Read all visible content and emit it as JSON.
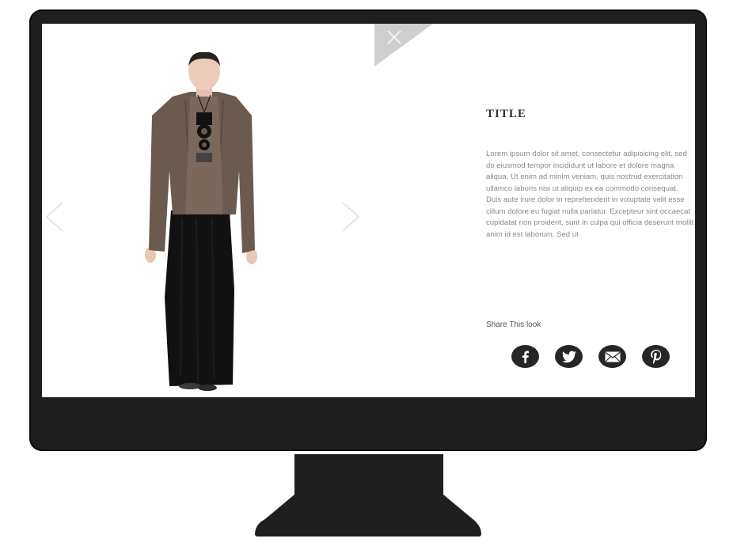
{
  "product": {
    "title": "TITLE",
    "description": "Lorem ipsum dolor sit amet, consectetur adipisicing elit, sed do eiusmod tempor incididunt ut labore et dolore magna aliqua. Ut enim ad minim veniam, quis nostrud exercitation ullamco laboris nisi ut aliquip ex ea commodo consequat. Duis aute irure dolor in reprehenderit in voluptate velit esse cillum dolore eu fugiat nulla pariatur. Excepteur sint occaecat cupidatat non proident, sunt in culpa qui officia deserunt mollit anim id est laborum. Sed ut"
  },
  "share": {
    "label": "Share This look",
    "buttons": [
      {
        "name": "facebook",
        "icon": "facebook-icon"
      },
      {
        "name": "twitter",
        "icon": "twitter-icon"
      },
      {
        "name": "email",
        "icon": "mail-icon"
      },
      {
        "name": "pinterest",
        "icon": "pinterest-icon"
      }
    ]
  },
  "colors": {
    "monitor": "#1f1f1f",
    "close_corner": "#cfcfcf",
    "share_button": "#262626",
    "body_text": "#8a8a8a"
  }
}
